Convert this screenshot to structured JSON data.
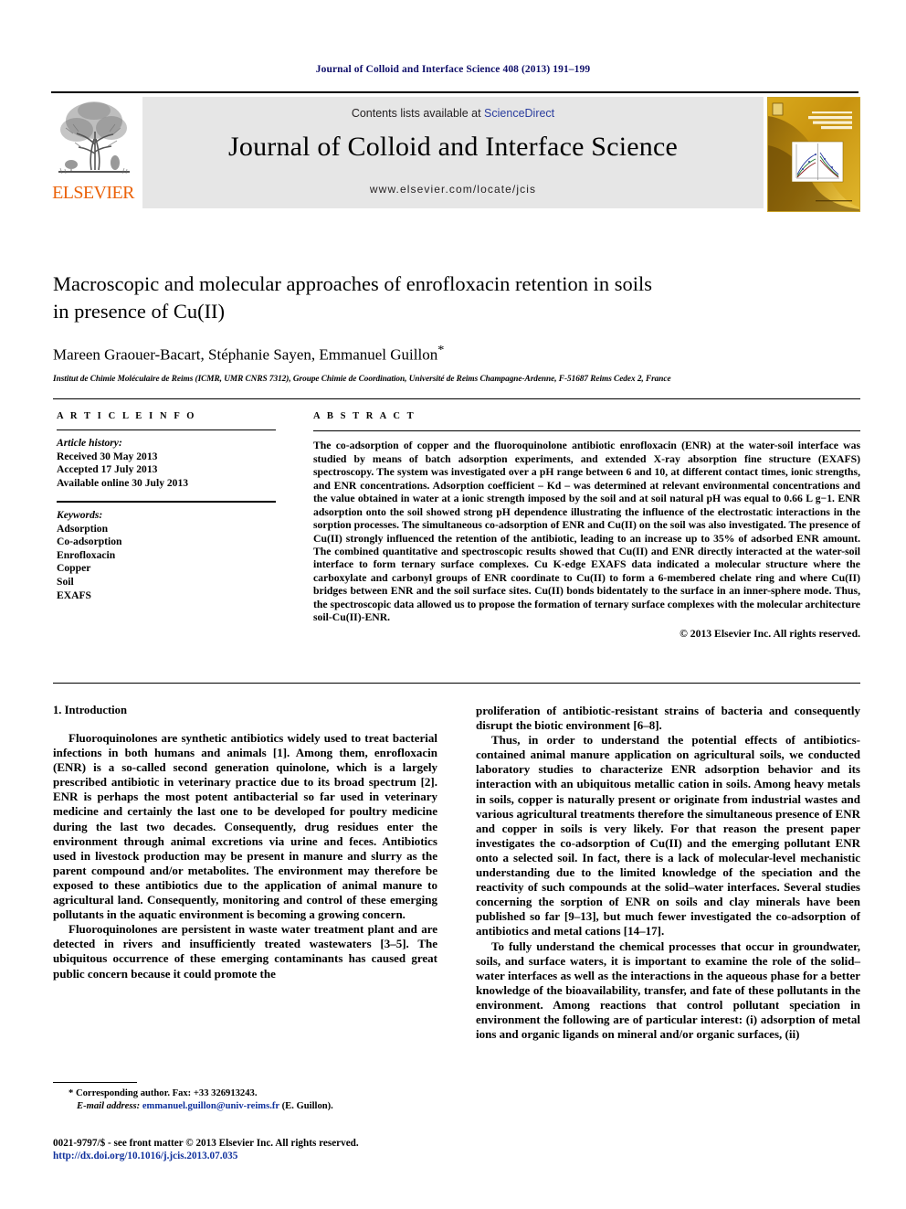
{
  "running_head": "Journal of Colloid and Interface Science 408 (2013) 191–199",
  "masthead": {
    "contents_prefix": "Contents lists available at ",
    "sciencedirect": "ScienceDirect",
    "journal_title": "Journal of Colloid and Interface Science",
    "journal_url": "www.elsevier.com/locate/jcis",
    "publisher": "ELSEVIER",
    "cover_title_small": "Journal of",
    "cover_title": "COLLOID AND INTERFACE SCIENCE",
    "accent_blue": "#2a3d9e",
    "accent_orange": "#eb6209",
    "cover_gold": "#c99a12",
    "band_grey": "#e6e6e6"
  },
  "article": {
    "title_line1": "Macroscopic and molecular approaches of enrofloxacin retention in soils",
    "title_line2": "in presence of Cu(II)",
    "authors": "Mareen Graouer-Bacart, Stéphanie Sayen, Emmanuel Guillon",
    "author_star": "*",
    "affiliation": "Institut de Chimie Moléculaire de Reims (ICMR, UMR CNRS 7312), Groupe Chimie de Coordination, Université de Reims Champagne-Ardenne, F-51687 Reims Cedex 2, France"
  },
  "article_info": {
    "heading": "A R T I C L E    I N F O",
    "history_label": "Article history:",
    "history": [
      "Received 30 May 2013",
      "Accepted 17 July 2013",
      "Available online 30 July 2013"
    ],
    "keywords_label": "Keywords:",
    "keywords": [
      "Adsorption",
      "Co-adsorption",
      "Enrofloxacin",
      "Copper",
      "Soil",
      "EXAFS"
    ]
  },
  "abstract": {
    "heading": "A B S T R A C T",
    "text": "The co-adsorption of copper and the fluoroquinolone antibiotic enrofloxacin (ENR) at the water-soil interface was studied by means of batch adsorption experiments, and extended X-ray absorption fine structure (EXAFS) spectroscopy. The system was investigated over a pH range between 6 and 10, at different contact times, ionic strengths, and ENR concentrations. Adsorption coefficient – Kd – was determined at relevant environmental concentrations and the value obtained in water at a ionic strength imposed by the soil and at soil natural pH was equal to 0.66 L g−1. ENR adsorption onto the soil showed strong pH dependence illustrating the influence of the electrostatic interactions in the sorption processes. The simultaneous co-adsorption of ENR and Cu(II) on the soil was also investigated. The presence of Cu(II) strongly influenced the retention of the antibiotic, leading to an increase up to 35% of adsorbed ENR amount. The combined quantitative and spectroscopic results showed that Cu(II) and ENR directly interacted at the water-soil interface to form ternary surface complexes. Cu K-edge EXAFS data indicated a molecular structure where the carboxylate and carbonyl groups of ENR coordinate to Cu(II) to form a 6-membered chelate ring and where Cu(II) bridges between ENR and the soil surface sites. Cu(II) bonds bidentately to the surface in an inner-sphere mode. Thus, the spectroscopic data allowed us to propose the formation of ternary surface complexes with the molecular architecture soil-Cu(II)-ENR.",
    "copyright": "© 2013 Elsevier Inc. All rights reserved."
  },
  "sections": {
    "intro_heading": "1. Introduction",
    "left_paragraphs": [
      "Fluoroquinolones are synthetic antibiotics widely used to treat bacterial infections in both humans and animals [1]. Among them, enrofloxacin (ENR) is a so-called second generation quinolone, which is a largely prescribed antibiotic in veterinary practice due to its broad spectrum [2]. ENR is perhaps the most potent antibacterial so far used in veterinary medicine and certainly the last one to be developed for poultry medicine during the last two decades. Consequently, drug residues enter the environment through animal excretions via urine and feces. Antibiotics used in livestock production may be present in manure and slurry as the parent compound and/or metabolites. The environment may therefore be exposed to these antibiotics due to the application of animal manure to agricultural land. Consequently, monitoring and control of these emerging pollutants in the aquatic environment is becoming a growing concern.",
      "Fluoroquinolones are persistent in waste water treatment plant and are detected in rivers and insufficiently treated wastewaters [3–5]. The ubiquitous occurrence of these emerging contaminants has caused great public concern because it could promote the"
    ],
    "right_paragraphs": [
      "proliferation of antibiotic-resistant strains of bacteria and consequently disrupt the biotic environment [6–8].",
      "Thus, in order to understand the potential effects of antibiotics-contained animal manure application on agricultural soils, we conducted laboratory studies to characterize ENR adsorption behavior and its interaction with an ubiquitous metallic cation in soils. Among heavy metals in soils, copper is naturally present or originate from industrial wastes and various agricultural treatments therefore the simultaneous presence of ENR and copper in soils is very likely. For that reason the present paper investigates the co-adsorption of Cu(II) and the emerging pollutant ENR onto a selected soil. In fact, there is a lack of molecular-level mechanistic understanding due to the limited knowledge of the speciation and the reactivity of such compounds at the solid–water interfaces. Several studies concerning the sorption of ENR on soils and clay minerals have been published so far [9–13], but much fewer investigated the co-adsorption of antibiotics and metal cations [14–17].",
      "To fully understand the chemical processes that occur in groundwater, soils, and surface waters, it is important to examine the role of the solid–water interfaces as well as the interactions in the aqueous phase for a better knowledge of the bioavailability, transfer, and fate of these pollutants in the environment. Among reactions that control pollutant speciation in environment the following are of particular interest: (i) adsorption of metal ions and organic ligands on mineral and/or organic surfaces, (ii)"
    ]
  },
  "footer": {
    "corresponding_marker": "*",
    "corresponding": "Corresponding author. Fax: +33 326913243.",
    "email_label": "E-mail address:",
    "email": "emmanuel.guillon@univ-reims.fr",
    "email_suffix": "(E. Guillon).",
    "imprint": "0021-9797/$ - see front matter © 2013 Elsevier Inc. All rights reserved.",
    "doi": "http://dx.doi.org/10.1016/j.jcis.2013.07.035"
  }
}
